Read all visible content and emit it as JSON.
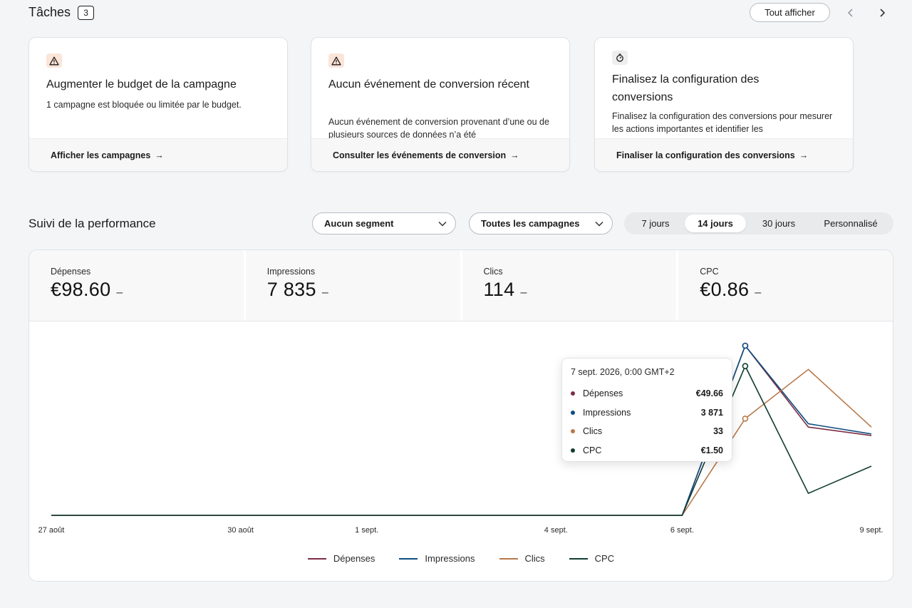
{
  "tasks": {
    "title": "Tâches",
    "count": "3",
    "show_all_label": "Tout afficher",
    "prev_icon": "chevron-left-icon",
    "next_icon": "chevron-right-icon",
    "cards": [
      {
        "icon": "warning-icon",
        "title": "Augmenter le budget de la campagne",
        "description": "1 campagne est bloquée ou limitée par le budget.",
        "action": "Afficher les campagnes"
      },
      {
        "icon": "warning-icon",
        "title": "Aucun événement de conversion récent",
        "description": "Aucun événement de conversion provenant d’une ou de plusieurs sources de données n’a été",
        "action": "Consulter les événements de conversion"
      },
      {
        "icon": "timer-icon",
        "title": "Finalisez la configuration des conversions",
        "description": "Finalisez la configuration des conversions pour mesurer les actions importantes et identifier les",
        "action": "Finaliser la configuration des conversions"
      }
    ]
  },
  "performance": {
    "title": "Suivi de la performance",
    "segment_dropdown": "Aucun segment",
    "campaign_dropdown": "Toutes les campagnes",
    "ranges": [
      "7 jours",
      "14 jours",
      "30 jours",
      "Personnalisé"
    ],
    "active_range": "14 jours",
    "metrics": [
      {
        "label": "Dépenses",
        "value": "€98.60",
        "trend": "–"
      },
      {
        "label": "Impressions",
        "value": "7 835",
        "trend": "–"
      },
      {
        "label": "Clics",
        "value": "114",
        "trend": "–"
      },
      {
        "label": "CPC",
        "value": "€0.86",
        "trend": "–"
      }
    ],
    "tooltip": {
      "title": "7 sept. 2026, 0:00 GMT+2",
      "rows": [
        {
          "name": "Dépenses",
          "value": "€49.66",
          "color": "#7b2d43"
        },
        {
          "name": "Impressions",
          "value": "3 871",
          "color": "#0f4c81"
        },
        {
          "name": "Clics",
          "value": "33",
          "color": "#b8784a"
        },
        {
          "name": "CPC",
          "value": "€1.50",
          "color": "#0f3d32"
        }
      ]
    }
  },
  "chart_data": {
    "type": "line",
    "x": [
      "27 août",
      "28 août",
      "29 août",
      "30 août",
      "31 août",
      "1 sept.",
      "2 sept.",
      "3 sept.",
      "4 sept.",
      "5 sept.",
      "6 sept.",
      "7 sept.",
      "8 sept.",
      "9 sept."
    ],
    "x_tick_labels": [
      "27 août",
      "30 août",
      "1 sept.",
      "4 sept.",
      "6 sept.",
      "9 sept."
    ],
    "series": [
      {
        "name": "Dépenses",
        "color": "#7b2d43",
        "values": [
          0,
          0,
          0,
          0,
          0,
          0,
          0,
          0,
          0,
          0,
          0,
          1.0,
          0.52,
          0.47
        ]
      },
      {
        "name": "Impressions",
        "color": "#0f4c81",
        "values": [
          0,
          0,
          0,
          0,
          0,
          0,
          0,
          0,
          0,
          0,
          0,
          1.0,
          0.54,
          0.48
        ]
      },
      {
        "name": "Clics",
        "color": "#b8784a",
        "values": [
          0,
          0,
          0,
          0,
          0,
          0,
          0,
          0,
          0,
          0,
          0,
          0.57,
          0.86,
          0.52
        ]
      },
      {
        "name": "CPC",
        "color": "#0f3d32",
        "values": [
          0,
          0,
          0,
          0,
          0,
          0,
          0,
          0,
          0,
          0,
          0,
          0.88,
          0.13,
          0.29
        ]
      }
    ],
    "ylim": [
      0,
      1
    ],
    "highlight_x": "7 sept.",
    "grid": false,
    "legend": "bottom-center"
  }
}
